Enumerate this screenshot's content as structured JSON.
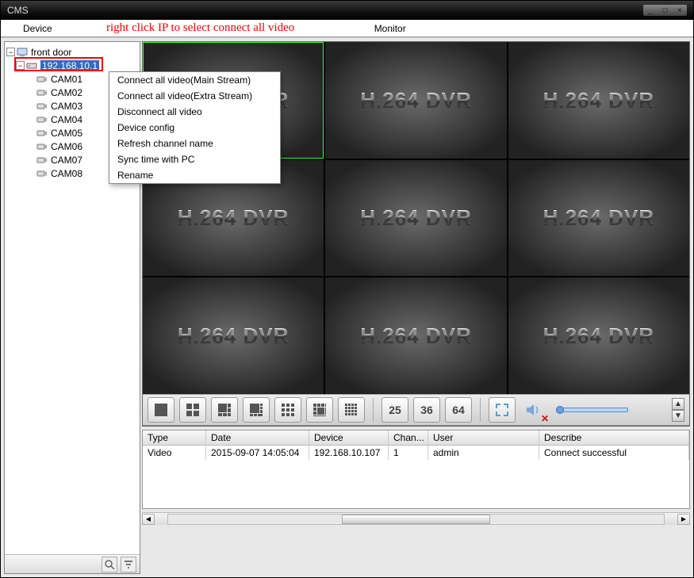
{
  "title": "CMS",
  "menu": {
    "device": "Device",
    "monitor": "Monitor"
  },
  "instruction": "right click IP to select connect all video",
  "tree": {
    "root": "front door",
    "ip": "192.168.10.1",
    "cams": [
      "CAM01",
      "CAM02",
      "CAM03",
      "CAM04",
      "CAM05",
      "CAM06",
      "CAM07",
      "CAM08"
    ]
  },
  "context": {
    "items": [
      "Connect all video(Main Stream)",
      "Connect all video(Extra Stream)",
      "Disconnect all video",
      "Device config",
      "Refresh channel name",
      "Sync time with PC",
      "Rename"
    ]
  },
  "videocell_label": "H.264 DVR",
  "layout_numbers": [
    "25",
    "36",
    "64"
  ],
  "log": {
    "headers": {
      "type": "Type",
      "date": "Date",
      "device": "Device",
      "chan": "Chan...",
      "user": "User",
      "desc": "Describe"
    },
    "row": {
      "type": "Video",
      "date": "2015-09-07 14:05:04",
      "device": "192.168.10.107",
      "chan": "1",
      "user": "admin",
      "desc": "Connect successful"
    }
  }
}
